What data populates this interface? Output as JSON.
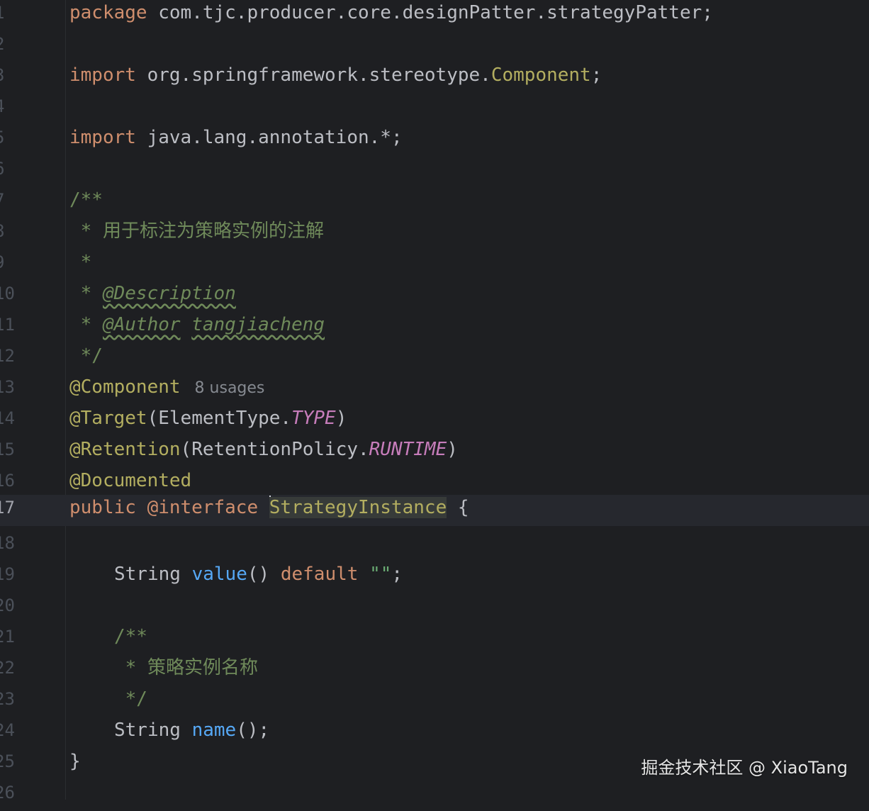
{
  "editor": {
    "line_numbers": [
      "1",
      "2",
      "3",
      "4",
      "5",
      "6",
      "7",
      "8",
      "9",
      "10",
      "11",
      "12",
      "13",
      "14",
      "15",
      "16",
      "17",
      "18",
      "19",
      "20",
      "21",
      "22",
      "23",
      "24",
      "25",
      "26"
    ],
    "current_line": "17",
    "lines": {
      "l1": {
        "kw": "package",
        "rest": " com.tjc.producer.core.designPatter.strategyPatter;"
      },
      "l3": {
        "kw": "import",
        "pkg": " org.springframework.stereotype.",
        "cls": "Component",
        "end": ";"
      },
      "l5": {
        "kw": "import",
        "rest": " java.lang.annotation.*;"
      },
      "l7": {
        "text": "/**"
      },
      "l8": {
        "star": " * ",
        "text": "用于标注为策略实例的注解"
      },
      "l9": {
        "text": " *"
      },
      "l10": {
        "star": " * ",
        "tag": "@Description"
      },
      "l11": {
        "star": " * ",
        "tag": "@Author",
        "value": "tangjiacheng"
      },
      "l12": {
        "text": " */"
      },
      "l13": {
        "ann": "@Component",
        "hint": "8 usages"
      },
      "l14": {
        "ann": "@Target",
        "open": "(ElementType.",
        "const": "TYPE",
        "close": ")"
      },
      "l15": {
        "ann": "@Retention",
        "open": "(RetentionPolicy.",
        "const": "RUNTIME",
        "close": ")"
      },
      "l16": {
        "ann": "@Documented"
      },
      "l17": {
        "kw": "public @interface",
        "name": "StrategyInstance",
        "brace": " {"
      },
      "l19": {
        "type": "String",
        "method": "value",
        "parens": "()",
        "kw": "default",
        "str": "\"\"",
        "end": ";"
      },
      "l21": {
        "text": "/**"
      },
      "l22": {
        "star": " * ",
        "text": "策略实例名称"
      },
      "l23": {
        "text": " */"
      },
      "l24": {
        "type": "String",
        "method": "name",
        "end": "();"
      },
      "l25": {
        "text": "}"
      }
    }
  },
  "watermark": "掘金技术社区 @ XiaoTang",
  "colors": {
    "background": "#1e1f22",
    "keyword": "#cf8e6d",
    "annotation": "#b3ae60",
    "comment": "#6f8a5a",
    "constant": "#c77dbb",
    "method": "#56a8f5",
    "string": "#6aab73",
    "text": "#bcbec4"
  }
}
